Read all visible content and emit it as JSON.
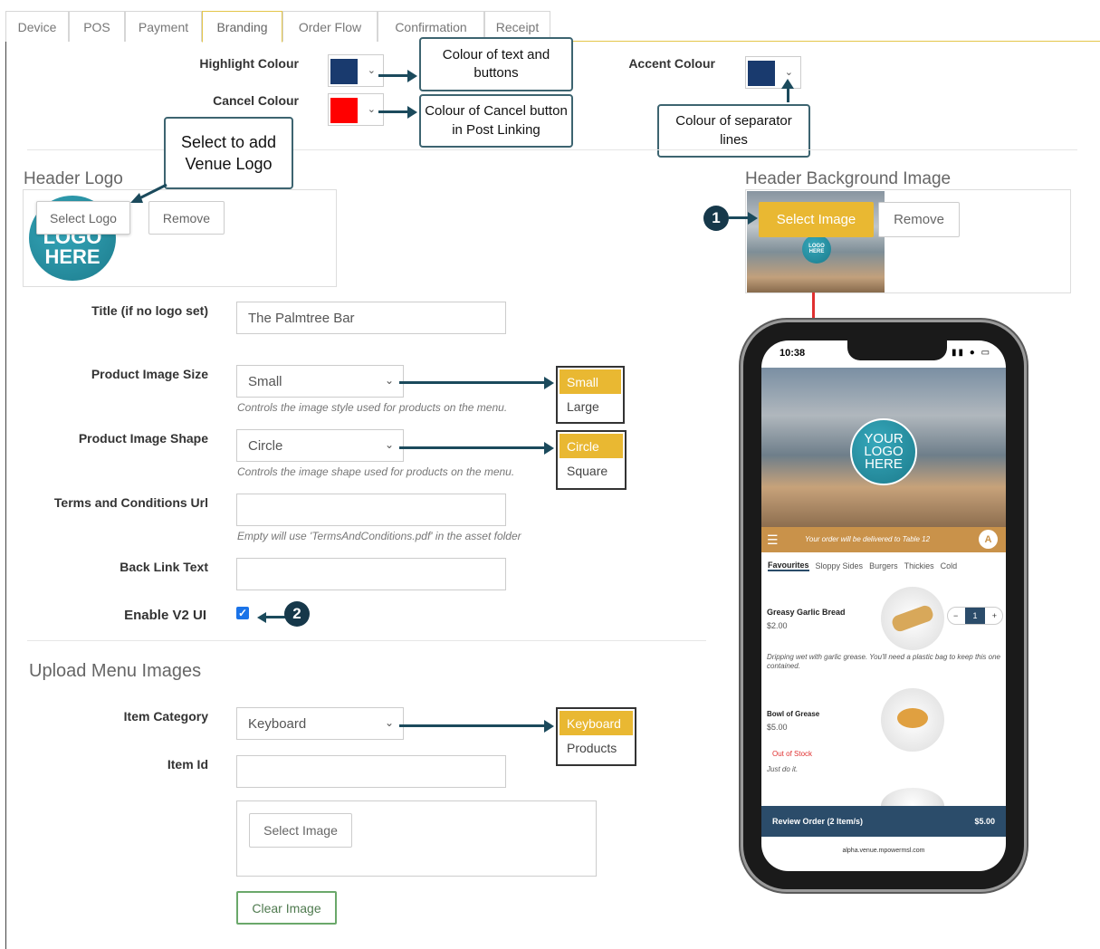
{
  "tabs": [
    "Device",
    "POS",
    "Payment",
    "Branding",
    "Order Flow",
    "Confirmation",
    "Receipt"
  ],
  "colors": {
    "highlight": "#193a6e",
    "cancel": "#ff0000",
    "accent": "#193a6e",
    "brand_yellow": "#e9b832",
    "annotation": "#1b4a5c",
    "red_arrow": "#e03030"
  },
  "branding": {
    "highlight_label": "Highlight Colour",
    "cancel_label": "Cancel Colour",
    "accent_label": "Accent Colour",
    "header_logo_title": "Header Logo",
    "header_bg_title": "Header Background Image",
    "select_logo": "Select Logo",
    "remove": "Remove",
    "select_image": "Select Image",
    "logo_text_1": "LOGO",
    "logo_text_2": "HERE",
    "title_label": "Title (if no logo set)",
    "title_value": "The Palmtree Bar",
    "product_size_label": "Product Image Size",
    "product_size_value": "Small",
    "product_size_hint": "Controls the image style used for products on the menu.",
    "product_shape_label": "Product Image Shape",
    "product_shape_value": "Circle",
    "product_shape_hint": "Controls the image shape used for products on the menu.",
    "terms_label": "Terms and Conditions Url",
    "terms_value": "",
    "terms_hint": "Empty will use 'TermsAndConditions.pdf' in the asset folder",
    "back_link_label": "Back Link Text",
    "back_link_value": "",
    "v2_label": "Enable V2 UI",
    "v2_checked": true
  },
  "upload": {
    "title": "Upload Menu Images",
    "category_label": "Item Category",
    "category_value": "Keyboard",
    "item_id_label": "Item Id",
    "item_id_value": "",
    "select_image": "Select Image",
    "clear_image": "Clear Image"
  },
  "callouts": {
    "highlight": "Colour of text and buttons",
    "cancel": "Colour of Cancel button in Post Linking",
    "logo": "Select to add Venue Logo",
    "separator": "Colour of separator lines"
  },
  "option_lists": {
    "size": [
      "Small",
      "Large"
    ],
    "shape": [
      "Circle",
      "Square"
    ],
    "category": [
      "Keyboard",
      "Products"
    ]
  },
  "markers": [
    "1",
    "2"
  ],
  "phone": {
    "time": "10:38",
    "logo_line1": "YOUR",
    "logo_line2": "LOGO",
    "logo_line3": "HERE",
    "delivery_text": "Your order will be delivered to Table 12",
    "avatar": "A",
    "tabs": [
      "Favourites",
      "Sloppy Sides",
      "Burgers",
      "Thickies",
      "Cold"
    ],
    "item1_name": "Greasy Garlic Bread",
    "item1_price": "$2.00",
    "item1_desc": "Dripping wet with garlic grease. You'll need a plastic bag to keep this one contained.",
    "item1_qty": "1",
    "item2_name": "Bowl of Grease",
    "item2_price": "$5.00",
    "item2_stock": "Out of Stock",
    "item2_desc": "Just do it.",
    "review_label": "Review Order (2 Item/s)",
    "review_total": "$5.00",
    "url": "alpha.venue.mpowermsl.com"
  }
}
